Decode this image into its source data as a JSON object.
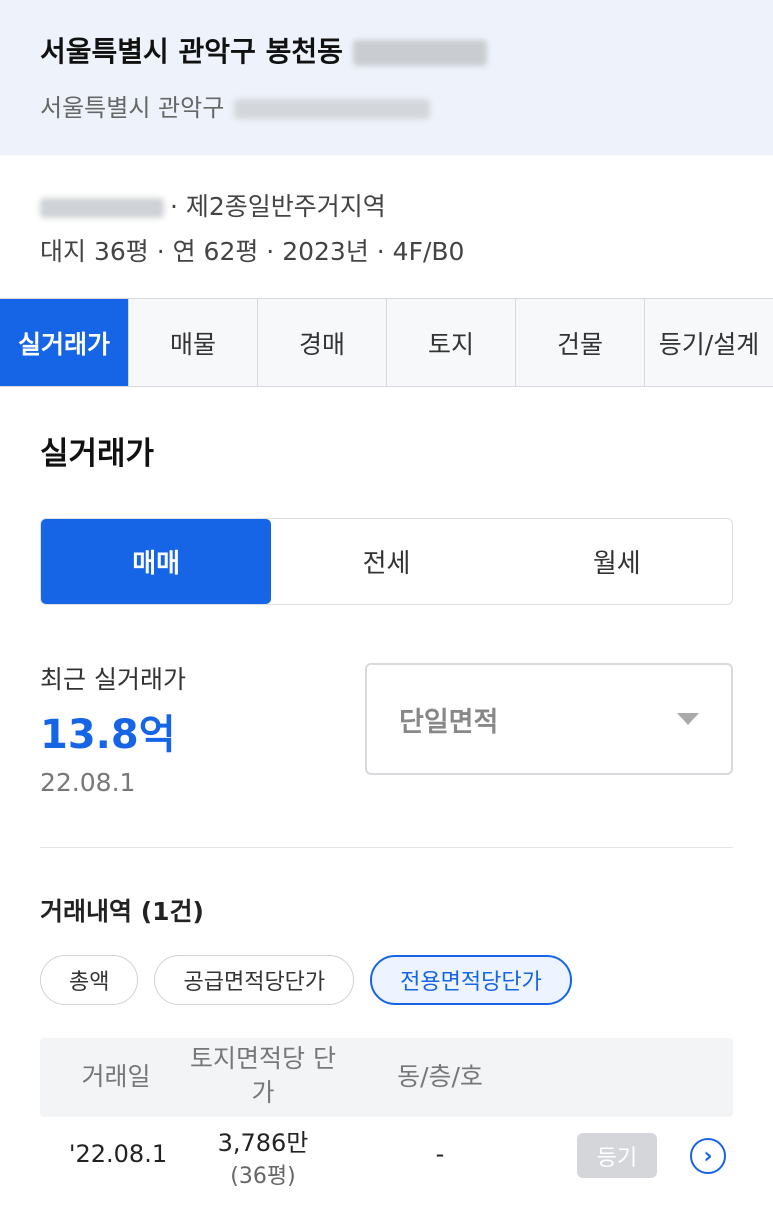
{
  "header": {
    "title": "서울특별시 관악구 봉천동",
    "subtitle": "서울특별시 관악구"
  },
  "info": {
    "zoning": "· 제2종일반주거지역",
    "summary": "대지 36평 · 연 62평 · 2023년 · 4F/B0"
  },
  "tabs": [
    {
      "label": "실거래가",
      "active": true
    },
    {
      "label": "매물"
    },
    {
      "label": "경매"
    },
    {
      "label": "토지"
    },
    {
      "label": "건물"
    },
    {
      "label": "등기/설계"
    }
  ],
  "section_title": "실거래가",
  "deal_types": [
    {
      "label": "매매",
      "active": true
    },
    {
      "label": "전세"
    },
    {
      "label": "월세"
    }
  ],
  "recent": {
    "label": "최근 실거래가",
    "price": "13.8억",
    "date": "22.08.1"
  },
  "area_filter": {
    "selected": "단일면적"
  },
  "history": {
    "title": "거래내역 (1건)",
    "chips": [
      {
        "label": "총액"
      },
      {
        "label": "공급면적당단가"
      },
      {
        "label": "전용면적당단가",
        "active": true
      }
    ],
    "columns": [
      "거래일",
      "토지면적당 단가",
      "동/층/호"
    ],
    "rows": [
      {
        "date": "'22.08.1",
        "unit_price": "3,786만",
        "area": "(36평)",
        "unit": "-",
        "badge": "등기"
      }
    ]
  },
  "colors": {
    "accent": "#1565e6",
    "header_bg": "#eef3fb"
  }
}
